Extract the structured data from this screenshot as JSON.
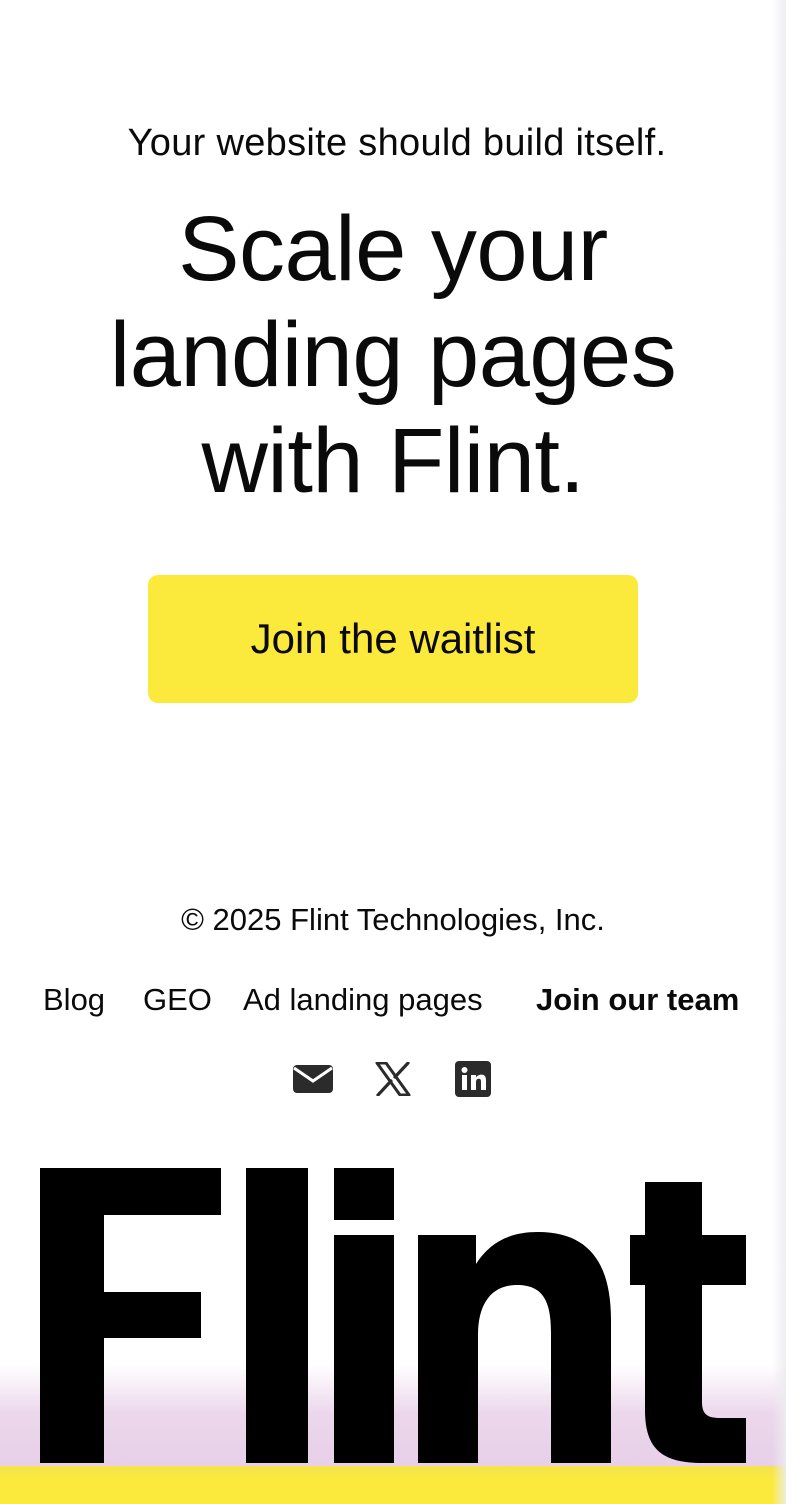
{
  "hero": {
    "tagline": "Your website should build itself.",
    "headline_lines": [
      "Scale your",
      "landing pages",
      "with Flint."
    ],
    "cta_label": "Join the waitlist"
  },
  "footer": {
    "copyright": "© 2025 Flint Technologies, Inc.",
    "nav": [
      {
        "label": "Blog"
      },
      {
        "label": "GEO"
      },
      {
        "label": "Ad landing pages"
      },
      {
        "label": "Join our team"
      }
    ],
    "social": [
      {
        "icon": "mail-icon"
      },
      {
        "icon": "x-icon"
      },
      {
        "icon": "linkedin-icon"
      }
    ]
  },
  "brand": {
    "wordmark": "Flint",
    "accent_color": "#fbea3b",
    "glow_color": "#e6cee8"
  }
}
